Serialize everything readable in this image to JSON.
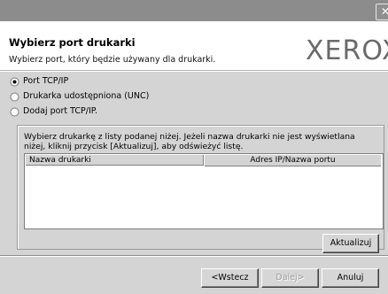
{
  "window": {
    "close_glyph": "✕"
  },
  "header": {
    "title": "Wybierz port drukarki",
    "subtitle": "Wybierz port, który będzie używany dla drukarki.",
    "logo": "XEROX"
  },
  "options": [
    {
      "label": "Port TCP/IP",
      "selected": true
    },
    {
      "label": "Drukarka udostępniona (UNC)",
      "selected": false
    },
    {
      "label": "Dodaj port TCP/IP.",
      "selected": false
    }
  ],
  "printer_list": {
    "instruction": "Wybierz drukarkę z listy podanej niżej. Jeżeli nazwa drukarki nie jest wyświetlana niżej, kliknij przycisk [Aktualizuj], aby odświeżyć listę.",
    "columns": [
      "Nazwa drukarki",
      "Adres IP/Nazwa portu"
    ],
    "rows": [],
    "refresh_label": "Aktualizuj"
  },
  "footer": {
    "back_label": "<Wstecz",
    "next_label": "Dalej>",
    "cancel_label": "Anuluj"
  }
}
